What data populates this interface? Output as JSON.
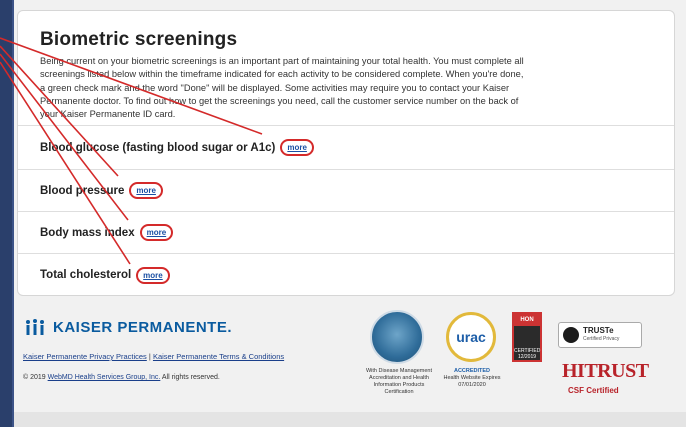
{
  "card": {
    "title": "Biometric screenings",
    "description": "Being current on your biometric screenings is an important part of maintaining your total health. You must complete all screenings listed below within the timeframe indicated for each activity to be considered complete. When you're done, a green check mark and the word \"Done\" will be displayed. Some activities may require you to contact your Kaiser Permanente doctor. To find out how to get the screenings you need, call the customer service number on the back of your Kaiser Permanente ID card.",
    "rows": [
      {
        "label": "Blood glucose (fasting blood sugar or A1c)",
        "link": "more"
      },
      {
        "label": "Blood pressure",
        "link": "more"
      },
      {
        "label": "Body mass index",
        "link": "more"
      },
      {
        "label": "Total cholesterol",
        "link": "more"
      }
    ]
  },
  "footer": {
    "brand": "KAISER PERMANENTE.",
    "privacy_link": "Kaiser Permanente Privacy Practices",
    "separator": " | ",
    "terms_link": "Kaiser Permanente Terms & Conditions",
    "copyright_prefix": "© 2019 ",
    "copyright_link": "WebMD Health Services Group, Inc.",
    "copyright_suffix": " All rights reserved.",
    "ncqa_caption": "With Disease Management Accreditation and Health Information Products Certification",
    "urac_text": "urac",
    "urac_caption_title": "ACCREDITED",
    "urac_caption": "Health Website Expires 07/01/2020",
    "hon_text": "HON",
    "hon_caption": "CERTIFIED 12/2019",
    "truste_title": "TRUSTe",
    "truste_sub": "Certified Privacy",
    "hitrust": "HITRUST",
    "hitrust_sub": "CSF Certified"
  },
  "colors": {
    "annotation_red": "#d42a2a",
    "link_blue": "#1a4fa3",
    "brand_blue": "#0a5b9f"
  }
}
